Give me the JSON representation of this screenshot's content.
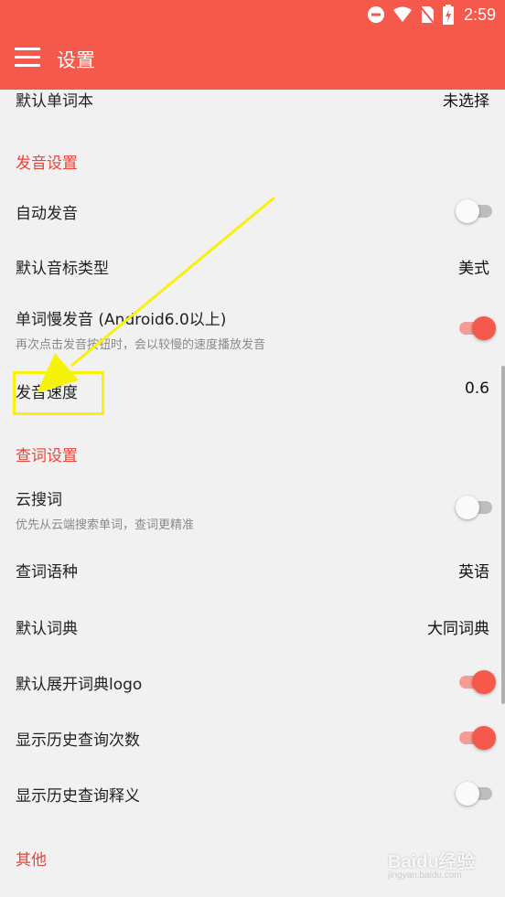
{
  "status_bar": {
    "time": "2:59"
  },
  "app_bar": {
    "title": "设置"
  },
  "settings": {
    "default_wordbook": {
      "label": "默认单词本",
      "value": "未选择"
    },
    "pronunciation_section": "发音设置",
    "auto_pronounce": {
      "label": "自动发音",
      "on": false
    },
    "phonetic_type": {
      "label": "默认音标类型",
      "value": "美式"
    },
    "slow_pronounce": {
      "label": "单词慢发音 (Android6.0以上)",
      "sub": "再次点击发音按钮时，会以较慢的速度播放发音",
      "on": true
    },
    "speed": {
      "label": "发音速度",
      "value": "0.6"
    },
    "lookup_section": "查词设置",
    "cloud_search": {
      "label": "云搜词",
      "sub": "优先从云端搜索单词，查词更精准",
      "on": false
    },
    "lookup_language": {
      "label": "查词语种",
      "value": "英语"
    },
    "default_dict": {
      "label": "默认词典",
      "value": "大同词典"
    },
    "expand_logo": {
      "label": "默认展开词典logo",
      "on": true
    },
    "show_history_count": {
      "label": "显示历史查询次数",
      "on": true
    },
    "show_history_meaning": {
      "label": "显示历史查询释义",
      "on": false
    },
    "other_section": "其他"
  },
  "watermark": {
    "main": "Baidu经验",
    "sub": "jingyan.baidu.com"
  },
  "colors": {
    "primary": "#f4594b",
    "accent_text": "#e8463b",
    "annotation": "#f6f20a"
  }
}
